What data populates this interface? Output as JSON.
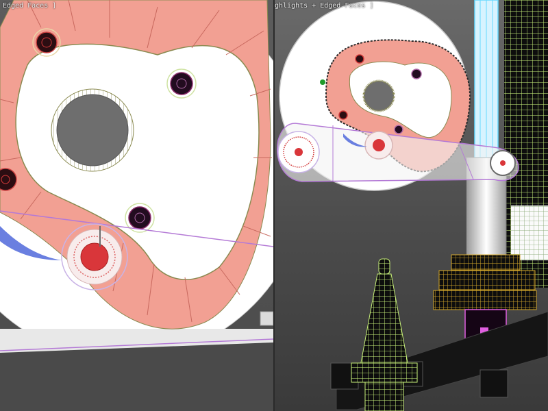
{
  "viewports": {
    "left": {
      "label": "Edged Faces ]"
    },
    "right": {
      "label": "ghlights + Edged Faces ]"
    }
  },
  "colors": {
    "background_top": "#5c5c5c",
    "cam_salmon": "#f2a093",
    "cam_face": "#ffffff",
    "link_lines": "#b47ad6",
    "wire_green": "#c9f27a",
    "wire_yellow": "#d4a72a",
    "wire_cyan": "#63d8ff",
    "dark_body": "#1a1a1a",
    "hole_fill": "#6e6e6e",
    "bearing_red": "#d9363a",
    "selection_blue": "#6a7fe0"
  }
}
